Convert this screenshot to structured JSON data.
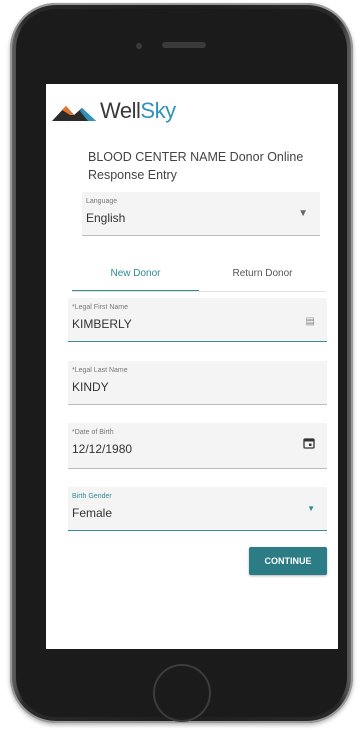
{
  "brand": {
    "name_part1": "Well",
    "name_part2": "Sky"
  },
  "page": {
    "title": "BLOOD CENTER NAME Donor Online Response Entry"
  },
  "language": {
    "label": "Language",
    "value": "English"
  },
  "tabs": [
    {
      "label": "New Donor",
      "selected": true
    },
    {
      "label": "Return Donor",
      "selected": false
    }
  ],
  "form": {
    "first_name": {
      "label": "*Legal First Name",
      "value": "KIMBERLY"
    },
    "last_name": {
      "label": "*Legal Last Name",
      "value": "KINDY"
    },
    "dob": {
      "label": "*Date of Birth",
      "value": "12/12/1980"
    },
    "gender": {
      "label": "Birth Gender",
      "value": "Female"
    }
  },
  "actions": {
    "continue_label": "CONTINUE"
  },
  "colors": {
    "accent": "#2c7c86",
    "brand_blue": "#2f93b8"
  }
}
